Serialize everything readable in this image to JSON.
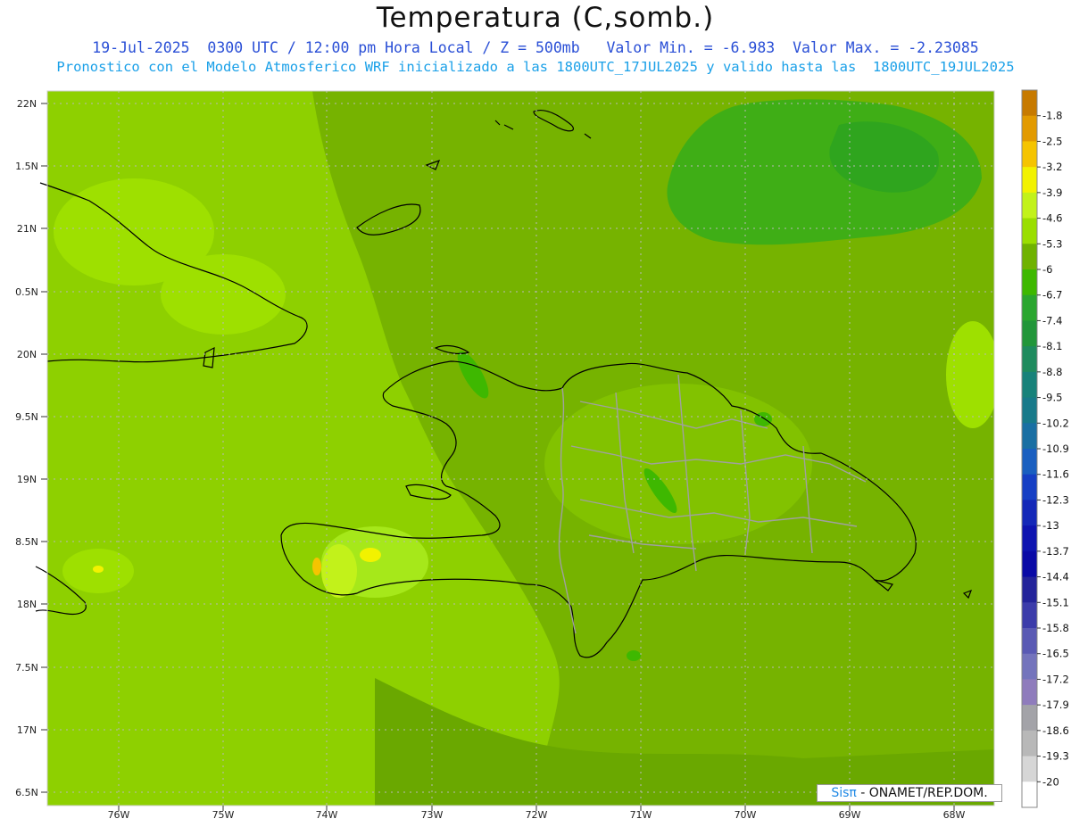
{
  "title": "Temperatura (C,somb.)",
  "subtitle_line1": "19-Jul-2025  0300 UTC / 12:00 pm Hora Local / Z = 500mb   Valor Min. = -6.983  Valor Max. = -2.23085",
  "subtitle_line2": "Pronostico con el Modelo Atmosferico WRF inicializado a las 1800UTC_17JUL2025 y valido hasta las  1800UTC_19JUL2025",
  "lat_labels": [
    "22N",
    "1.5N",
    "21N",
    "0.5N",
    "20N",
    "9.5N",
    "19N",
    "8.5N",
    "18N",
    "7.5N",
    "17N",
    "6.5N"
  ],
  "lon_labels": [
    "76W",
    "75W",
    "74W",
    "73W",
    "72W",
    "71W",
    "70W",
    "69W",
    "68W"
  ],
  "colorbar": {
    "labels": [
      "-1.8",
      "-2.5",
      "-3.2",
      "-3.9",
      "-4.6",
      "-5.3",
      "-6",
      "-6.7",
      "-7.4",
      "-8.1",
      "-8.8",
      "-9.5",
      "-10.2",
      "-10.9",
      "-11.6",
      "-12.3",
      "-13",
      "-13.7",
      "-14.4",
      "-15.1",
      "-15.8",
      "-16.5",
      "-17.2",
      "-17.9",
      "-18.6",
      "-19.3",
      "-20"
    ],
    "colors": [
      "#c77a00",
      "#e29a00",
      "#f5c400",
      "#f2f200",
      "#c2f21a",
      "#9ade00",
      "#6fb200",
      "#3eb800",
      "#2ba62f",
      "#22963a",
      "#1f8b5e",
      "#18827a",
      "#187a8a",
      "#1a6fa3",
      "#1a5fc0",
      "#163fc4",
      "#1428b8",
      "#0e14b0",
      "#0a0aa6",
      "#24249a",
      "#3c3caa",
      "#5a5ab4",
      "#7474bc",
      "#8f7cbc",
      "#a3a3a8",
      "#b8b8b8",
      "#d6d6d6",
      "#ffffff"
    ]
  },
  "credit": {
    "brand": "Sisπ",
    "text": " - ONAMET/REP.DOM."
  },
  "field_colors": {
    "light": "#8ed000",
    "mid": "#76b300",
    "dark": "#5fa000",
    "bright": "#b6ee2a",
    "deep": "#2fa51e"
  }
}
